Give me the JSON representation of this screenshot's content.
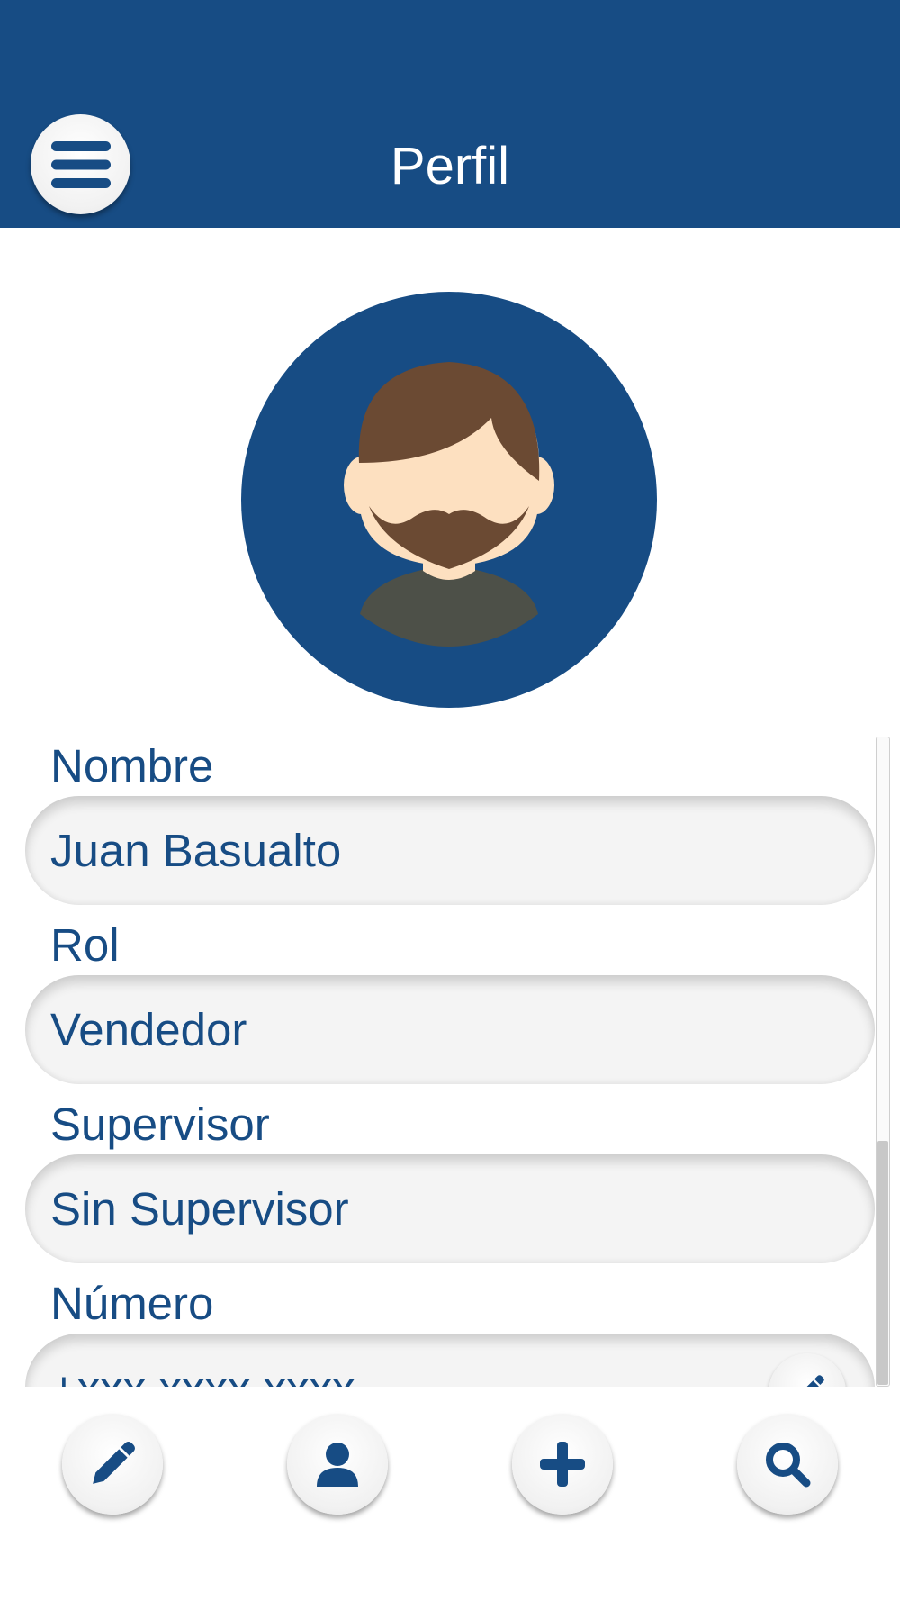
{
  "header": {
    "title": "Perfil",
    "menu_icon": "hamburger-menu-icon",
    "background_color": "#174c84"
  },
  "profile": {
    "avatar_icon": "bearded-man-avatar-icon"
  },
  "fields": [
    {
      "label": "Nombre",
      "value": "Juan Basualto"
    },
    {
      "label": "Rol",
      "value": "Vendedor"
    },
    {
      "label": "Supervisor",
      "value": "Sin Supervisor"
    },
    {
      "label": "Número",
      "value": "+xxx xxxx xxxx",
      "action_icon": "pencil-icon"
    }
  ],
  "bottom_nav": [
    {
      "name": "edit",
      "icon": "pencil-icon"
    },
    {
      "name": "profile",
      "icon": "user-icon"
    },
    {
      "name": "add",
      "icon": "plus-icon"
    },
    {
      "name": "search",
      "icon": "search-icon"
    }
  ],
  "colors": {
    "accent": "#174c84",
    "field_bg": "#f4f4f4",
    "page_bg": "#ffffff"
  }
}
